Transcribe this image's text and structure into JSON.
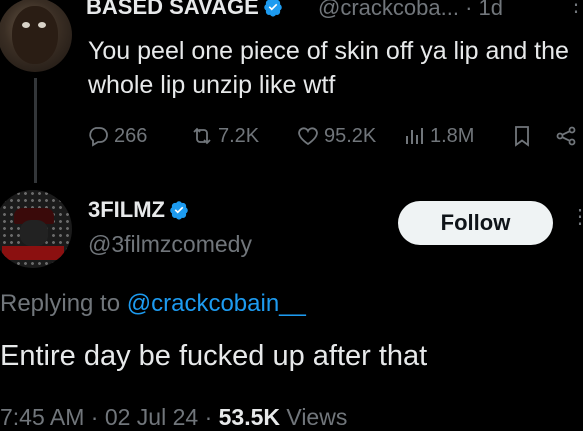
{
  "tweet": {
    "author_name": "BASED SAVAGE",
    "handle": "@crackcoba...",
    "time": "· 1d",
    "text": "You peel one piece of skin off ya lip and the whole lip unzip like wtf",
    "replies": "266",
    "retweets": "7.2K",
    "likes": "95.2K",
    "views": "1.8M"
  },
  "reply": {
    "author_name": "3FILMZ",
    "handle": "@3filmzcomedy",
    "follow_label": "Follow",
    "replying_prefix": "Replying to",
    "replying_to": "@crackcobain__",
    "text": "Entire day be fucked up after that",
    "timestamp": "7:45 AM · 02 Jul 24 ·",
    "views_count": "53.5K",
    "views_label": "Views"
  },
  "colors": {
    "background": "#000000",
    "text": "#e7e9ea",
    "muted": "#71767b",
    "accent": "#1d9bf0"
  }
}
